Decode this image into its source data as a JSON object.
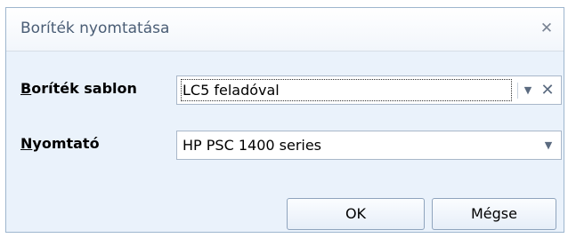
{
  "dialog": {
    "title": "Boríték nyomtatása",
    "close_icon": "close-icon"
  },
  "envelope_template": {
    "label_mnemonic": "B",
    "label_rest": "oríték sablon",
    "value": "LC5 feladóval"
  },
  "printer": {
    "label_mnemonic": "N",
    "label_rest": "yomtató",
    "value": "HP PSC 1400 series"
  },
  "buttons": {
    "ok": "OK",
    "cancel": "Mégse"
  }
}
